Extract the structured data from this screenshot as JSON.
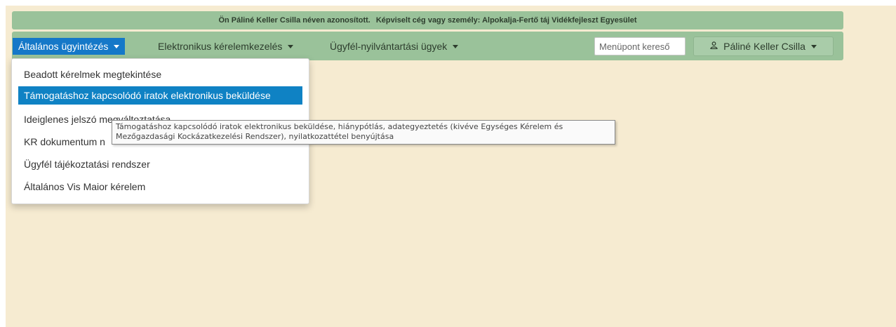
{
  "infobar": {
    "identified_text": "Ön Páliné Keller Csilla néven azonosított.",
    "represented_text": "Képviselt cég vagy személy: Alpokalja-Fertő táj Vidékfejleszt Egyesület"
  },
  "nav": {
    "items": [
      {
        "label": "Általános ügyintézés",
        "active": true
      },
      {
        "label": "Elektronikus kérelemkezelés",
        "active": false
      },
      {
        "label": "Ügyfél-nyilvántartási ügyek",
        "active": false
      }
    ],
    "search_placeholder": "Menüpont kereső",
    "user_name": "Páliné Keller Csilla"
  },
  "dropdown": {
    "items": [
      {
        "label": "Beadott kérelmek megtekintése",
        "active": false
      },
      {
        "label": "Támogatáshoz kapcsolódó iratok elektronikus beküldése",
        "active": true
      },
      {
        "label": "Ideiglenes jelszó megváltoztatása",
        "active": false
      },
      {
        "label": "KR dokumentum n",
        "active": false
      },
      {
        "label": "Ügyfél tájékoztatási rendszer",
        "active": false
      },
      {
        "label": "Általános Vis Maior kérelem",
        "active": false
      }
    ]
  },
  "tooltip": {
    "line1": "Támogatáshoz kapcsolódó iratok elektronikus beküldése, hiánypótlás, adategyeztetés (kivéve Egységes Kérelem és",
    "line2": "Mezőgazdasági Kockázatkezelési Rendszer), nyilatkozattétel benyújtása"
  },
  "colors": {
    "page_background": "#f6ebd1",
    "navbar_green": "#9ac29a",
    "active_blue": "#1578c8",
    "dropdown_active_blue": "#0f82c4"
  },
  "icons": {
    "user": "user-icon",
    "caret": "caret-down-icon"
  }
}
